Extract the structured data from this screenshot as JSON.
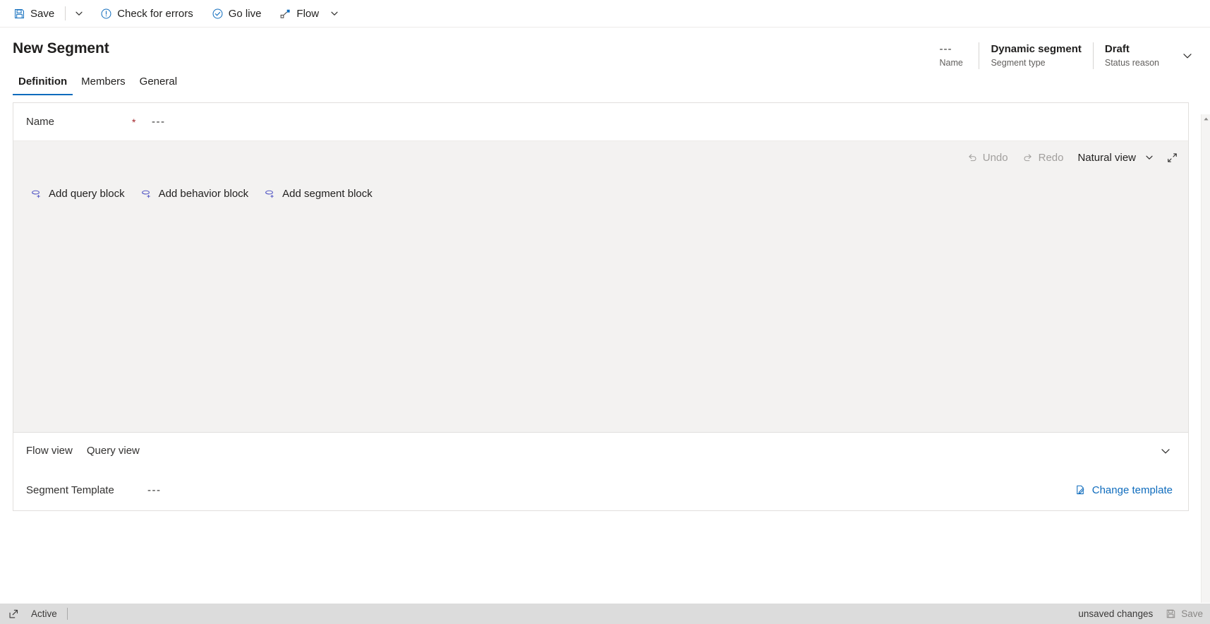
{
  "commandbar": {
    "save_label": "Save",
    "save_dropdown_icon": "chevron-down-icon",
    "save_icon": "save-disk-icon",
    "check_errors_label": "Check for errors",
    "check_errors_icon": "exclamation-circle-icon",
    "golive_label": "Go live",
    "golive_icon": "check-circle-icon",
    "flow_label": "Flow",
    "flow_icon": "flow-icon",
    "flow_dropdown_icon": "chevron-down-icon"
  },
  "header": {
    "title": "New Segment",
    "meta": [
      {
        "value": "---",
        "label": "Name",
        "dim": true
      },
      {
        "value": "Dynamic segment",
        "label": "Segment type",
        "dim": false
      },
      {
        "value": "Draft",
        "label": "Status reason",
        "dim": false
      }
    ],
    "expand_icon": "chevron-down-icon"
  },
  "tabs": [
    {
      "label": "Definition",
      "active": true
    },
    {
      "label": "Members",
      "active": false
    },
    {
      "label": "General",
      "active": false
    }
  ],
  "form": {
    "name_label": "Name",
    "name_required_mark": "*",
    "name_value": "---"
  },
  "canvas": {
    "undo_label": "Undo",
    "undo_icon": "undo-arrow-icon",
    "undo_disabled": true,
    "redo_label": "Redo",
    "redo_icon": "redo-arrow-icon",
    "redo_disabled": true,
    "view_mode_label": "Natural view",
    "view_mode_caret_icon": "chevron-down-icon",
    "fullscreen_icon": "expand-diagonal-icon",
    "add_blocks": [
      {
        "label": "Add query block",
        "icon": "add-query-block-icon"
      },
      {
        "label": "Add behavior block",
        "icon": "add-behavior-block-icon"
      },
      {
        "label": "Add segment block",
        "icon": "add-segment-block-icon"
      }
    ]
  },
  "viewtabs": [
    {
      "label": "Flow view"
    },
    {
      "label": "Query view"
    }
  ],
  "viewtabs_collapse_icon": "chevron-down-icon",
  "template": {
    "label": "Segment Template",
    "value": "---",
    "change_label": "Change template",
    "change_icon": "page-edit-icon"
  },
  "statusbar": {
    "popout_icon": "popout-icon",
    "status_text": "Active",
    "unsaved_text": "unsaved changes",
    "save_label": "Save",
    "save_icon": "save-disk-icon"
  },
  "scrollbar": {
    "up_icon": "caret-up-icon"
  },
  "colors": {
    "accent": "#0f6cbd",
    "required": "#a4262c",
    "canvas_bg": "#f3f2f1",
    "statusbar_bg": "#dcdcdc"
  }
}
